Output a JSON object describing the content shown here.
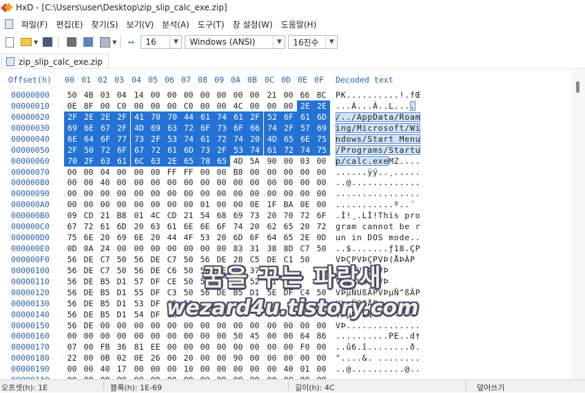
{
  "window": {
    "title": "HxD - [C:\\Users\\user\\Desktop\\zip_slip_calc_exe.zip]"
  },
  "menu": [
    "파일(F)",
    "편집(E)",
    "찾기(S)",
    "보기(V)",
    "분석(A)",
    "도구(T)",
    "창 설정(W)",
    "도움말(H)"
  ],
  "toolbar": {
    "bytes_per_row": "16",
    "charset": "Windows (ANSI)",
    "offset_base": "16진수"
  },
  "tab": {
    "label": "zip_slip_calc_exe.zip"
  },
  "hex_header": {
    "offset_label": "Offset(h)",
    "columns": [
      "00",
      "01",
      "02",
      "03",
      "04",
      "05",
      "06",
      "07",
      "08",
      "09",
      "0A",
      "0B",
      "0C",
      "0D",
      "0E",
      "0F"
    ],
    "decoded_label": "Decoded text"
  },
  "rows": [
    {
      "offset": "00000000",
      "bytes": [
        "50",
        "4B",
        "03",
        "04",
        "14",
        "00",
        "00",
        "00",
        "00",
        "00",
        "00",
        "00",
        "21",
        "00",
        "66",
        "8C"
      ],
      "text": "PK..........!.fŒ"
    },
    {
      "offset": "00000010",
      "bytes": [
        "0E",
        "8F",
        "00",
        "C0",
        "00",
        "00",
        "00",
        "C0",
        "00",
        "00",
        "4C",
        "00",
        "00",
        "00",
        "2E",
        "2E"
      ],
      "text": "...À...À..L...."
    },
    {
      "offset": "00000020",
      "bytes": [
        "2F",
        "2E",
        "2E",
        "2F",
        "41",
        "70",
        "70",
        "44",
        "61",
        "74",
        "61",
        "2F",
        "52",
        "6F",
        "61",
        "6D"
      ],
      "text": "/../AppData/Roam"
    },
    {
      "offset": "00000030",
      "bytes": [
        "69",
        "6E",
        "67",
        "2F",
        "4D",
        "69",
        "63",
        "72",
        "6F",
        "73",
        "6F",
        "66",
        "74",
        "2F",
        "57",
        "69"
      ],
      "text": "ing/Microsoft/Wi"
    },
    {
      "offset": "00000040",
      "bytes": [
        "6E",
        "64",
        "6F",
        "77",
        "73",
        "2F",
        "53",
        "74",
        "61",
        "72",
        "74",
        "20",
        "4D",
        "65",
        "6E",
        "75"
      ],
      "text": "ndows/Start Menu"
    },
    {
      "offset": "00000050",
      "bytes": [
        "2F",
        "50",
        "72",
        "6F",
        "67",
        "72",
        "61",
        "6D",
        "73",
        "2F",
        "53",
        "74",
        "61",
        "72",
        "74",
        "75"
      ],
      "text": "/Programs/Startu"
    },
    {
      "offset": "00000060",
      "bytes": [
        "70",
        "2F",
        "63",
        "61",
        "6C",
        "63",
        "2E",
        "65",
        "78",
        "65",
        "4D",
        "5A",
        "90",
        "00",
        "03",
        "00"
      ],
      "text": "p/calc.exeMZ...."
    },
    {
      "offset": "00000070",
      "bytes": [
        "00",
        "00",
        "04",
        "00",
        "00",
        "00",
        "FF",
        "FF",
        "00",
        "00",
        "B8",
        "00",
        "00",
        "00",
        "00",
        "00"
      ],
      "text": "......ÿÿ..¸....."
    },
    {
      "offset": "00000080",
      "bytes": [
        "00",
        "00",
        "40",
        "00",
        "00",
        "00",
        "00",
        "00",
        "00",
        "00",
        "00",
        "00",
        "00",
        "00",
        "00",
        "00"
      ],
      "text": "..@............."
    },
    {
      "offset": "00000090",
      "bytes": [
        "00",
        "00",
        "00",
        "00",
        "00",
        "00",
        "00",
        "00",
        "00",
        "00",
        "00",
        "00",
        "00",
        "00",
        "00",
        "00"
      ],
      "text": "................"
    },
    {
      "offset": "000000A0",
      "bytes": [
        "00",
        "00",
        "00",
        "00",
        "00",
        "00",
        "00",
        "00",
        "01",
        "00",
        "00",
        "0E",
        "1F",
        "BA",
        "0E",
        "00",
        "B4"
      ],
      "text": "...........º..´"
    },
    {
      "offset": "000000B0",
      "bytes": [
        "09",
        "CD",
        "21",
        "B8",
        "01",
        "4C",
        "CD",
        "21",
        "54",
        "68",
        "69",
        "73",
        "20",
        "70",
        "72",
        "6F"
      ],
      "text": ".Í!¸.LÍ!This pro"
    },
    {
      "offset": "000000C0",
      "bytes": [
        "67",
        "72",
        "61",
        "6D",
        "20",
        "63",
        "61",
        "6E",
        "6E",
        "6F",
        "74",
        "20",
        "62",
        "65",
        "20",
        "72"
      ],
      "text": "gram cannot be r"
    },
    {
      "offset": "000000D0",
      "bytes": [
        "75",
        "6E",
        "20",
        "69",
        "6E",
        "20",
        "44",
        "4F",
        "53",
        "20",
        "6D",
        "6F",
        "64",
        "65",
        "2E",
        "0D"
      ],
      "text": "un in DOS mode.."
    },
    {
      "offset": "000000E0",
      "bytes": [
        "0D",
        "0A",
        "24",
        "00",
        "00",
        "00",
        "00",
        "00",
        "00",
        "00",
        "83",
        "31",
        "38",
        "8D",
        "C7",
        "50"
      ],
      "text": "..$.......ƒ18.ÇP"
    },
    {
      "offset": "000000F0",
      "bytes": [
        "56",
        "DE",
        "C7",
        "50",
        "56",
        "DE",
        "C7",
        "50",
        "56",
        "DE",
        "28",
        "C5",
        "DE",
        "C1",
        "50"
      ],
      "text": "VÞÇPVÞÇPVÞ(ÅÞÁP"
    },
    {
      "offset": "00000100",
      "bytes": [
        "56",
        "DE",
        "C7",
        "50",
        "56",
        "DE",
        "C6",
        "50",
        "56",
        "DE",
        "",
        "37",
        "",
        "",
        "",
        "",
        "",
        ""
      ],
      "text": "VÞÇPVÞÆPVÞ"
    },
    {
      "offset": "00000110",
      "bytes": [
        "56",
        "DE",
        "B5",
        "D1",
        "57",
        "DF",
        "CE",
        "50",
        "56",
        "",
        "",
        "52",
        "D1",
        "",
        "",
        ""
      ],
      "text": "VÞµÑWßÎPVÞ"
    },
    {
      "offset": "00000120",
      "bytes": [
        "56",
        "DE",
        "B5",
        "D1",
        "55",
        "DF",
        "C3",
        "50",
        "56",
        "DE",
        "B5",
        "D1",
        "5E",
        "DF",
        "C4",
        "50"
      ],
      "text": "VÞµÑUßÃPVÞµÑ^ßÄP"
    },
    {
      "offset": "00000130",
      "bytes": [
        "56",
        "DE",
        "B5",
        "D1",
        "53",
        "DF",
        "C5",
        "50",
        "",
        "",
        "",
        "",
        "",
        "",
        "",
        ""
      ],
      "text": "VÞµÑSßÅP"
    },
    {
      "offset": "00000140",
      "bytes": [
        "56",
        "DE",
        "B5",
        "D1",
        "54",
        "DF",
        "C6",
        "",
        "",
        "",
        "",
        "",
        "",
        "",
        "",
        ""
      ],
      "text": "VÞµÑTßÆ"
    },
    {
      "offset": "00000150",
      "bytes": [
        "56",
        "DE",
        "00",
        "00",
        "00",
        "00",
        "00",
        "00",
        "00",
        "00",
        "00",
        "00",
        "00",
        "00",
        "00",
        "00"
      ],
      "text": "VÞ.............."
    },
    {
      "offset": "00000160",
      "bytes": [
        "00",
        "00",
        "00",
        "00",
        "00",
        "00",
        "00",
        "00",
        "00",
        "00",
        "50",
        "45",
        "00",
        "00",
        "64",
        "86"
      ],
      "text": "..........PE..d†"
    },
    {
      "offset": "00000170",
      "bytes": [
        "07",
        "00",
        "FB",
        "36",
        "81",
        "EE",
        "00",
        "00",
        "00",
        "00",
        "00",
        "00",
        "00",
        "00",
        "F0",
        "00"
      ],
      "text": "..û6.î........ð."
    },
    {
      "offset": "00000180",
      "bytes": [
        "22",
        "00",
        "0B",
        "02",
        "0E",
        "26",
        "00",
        "20",
        "00",
        "00",
        "90",
        "00",
        "00",
        "00",
        "00",
        "00"
      ],
      "text": "\"....&. ........"
    },
    {
      "offset": "00000190",
      "bytes": [
        "00",
        "00",
        "40",
        "17",
        "00",
        "00",
        "00",
        "10",
        "00",
        "00",
        "00",
        "00",
        "00",
        "40",
        "01",
        "00"
      ],
      "text": "..@..........@.."
    },
    {
      "offset": "000001A0",
      "bytes": [
        "00",
        "00",
        "00",
        "00",
        "00",
        "00",
        "00",
        "00",
        "00",
        "00",
        "00",
        "00",
        "00",
        "00",
        "00",
        "00"
      ],
      "text": "................"
    }
  ],
  "status": {
    "offset": "오프셋(h): 1E",
    "block": "블록(h): 1E-69",
    "length": "길이(h): 4C",
    "mode": "덮어쓰기"
  },
  "watermark": {
    "line1": "꿈을 꾸는 파랑새",
    "line2": "wezard4u.tistory.com"
  },
  "colors": {
    "selection": "#2472d6",
    "offset_blue": "#2a5ea8"
  }
}
